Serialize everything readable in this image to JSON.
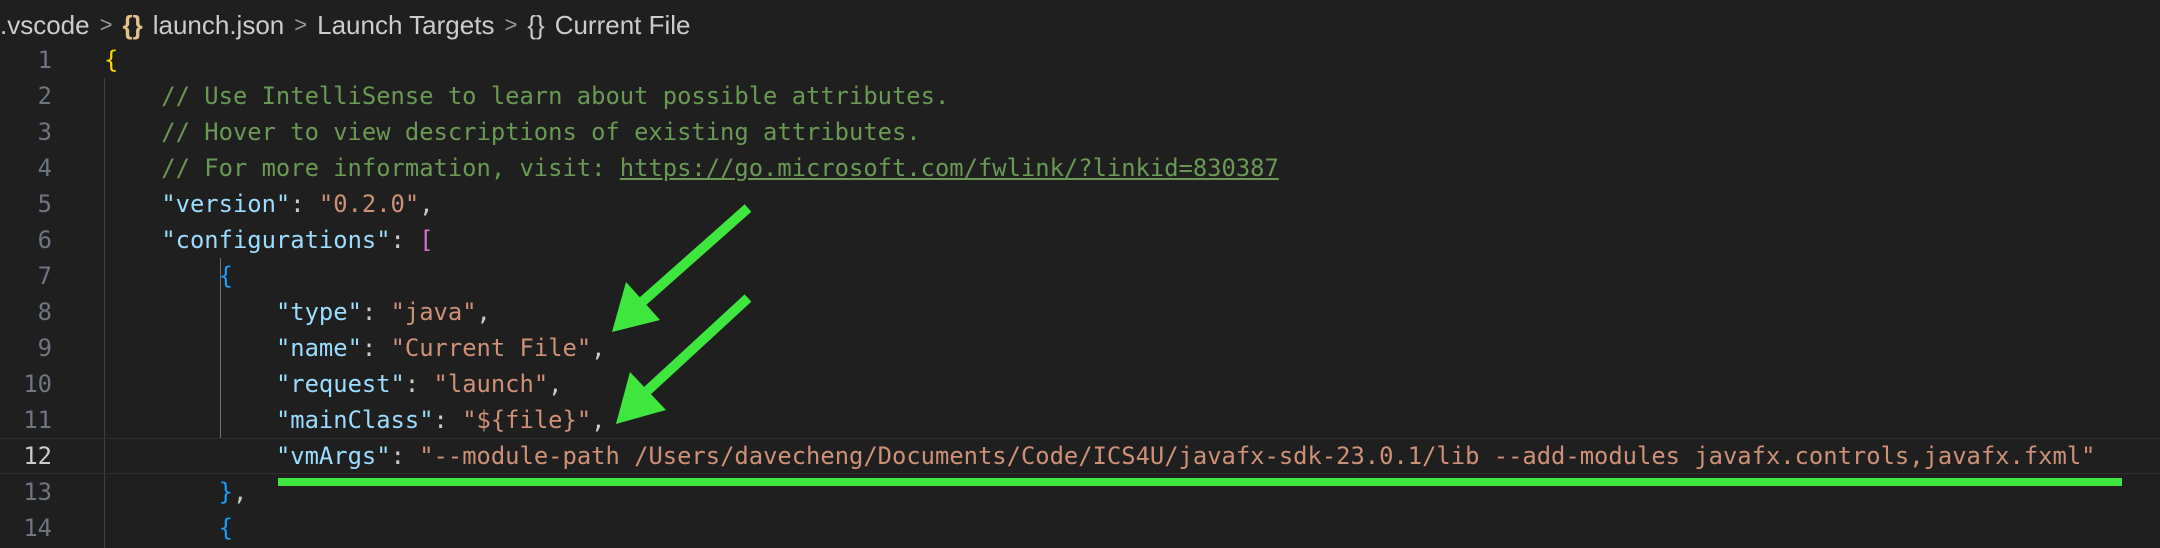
{
  "breadcrumb": {
    "items": [
      ".vscode",
      "launch.json",
      "Launch Targets",
      "Current File"
    ],
    "json_icon": "{}",
    "object_icon": "{}",
    "separator": ">"
  },
  "editor": {
    "current_line": 12,
    "lines": [
      {
        "n": "1",
        "tokens": [
          {
            "t": "{",
            "c": "brace1"
          }
        ]
      },
      {
        "n": "2",
        "tokens": [
          {
            "t": "    // Use IntelliSense to learn about possible attributes.",
            "c": "comment"
          }
        ]
      },
      {
        "n": "3",
        "tokens": [
          {
            "t": "    // Hover to view descriptions of existing attributes.",
            "c": "comment"
          }
        ]
      },
      {
        "n": "4",
        "tokens": [
          {
            "t": "    // For more information, visit: ",
            "c": "comment"
          },
          {
            "t": "https://go.microsoft.com/fwlink/?linkid=830387",
            "c": "comment link"
          }
        ]
      },
      {
        "n": "5",
        "tokens": [
          {
            "t": "    ",
            "c": "punc"
          },
          {
            "t": "\"version\"",
            "c": "key"
          },
          {
            "t": ": ",
            "c": "punc"
          },
          {
            "t": "\"0.2.0\"",
            "c": "str"
          },
          {
            "t": ",",
            "c": "punc"
          }
        ]
      },
      {
        "n": "6",
        "tokens": [
          {
            "t": "    ",
            "c": "punc"
          },
          {
            "t": "\"configurations\"",
            "c": "key"
          },
          {
            "t": ": ",
            "c": "punc"
          },
          {
            "t": "[",
            "c": "brack2"
          }
        ]
      },
      {
        "n": "7",
        "tokens": [
          {
            "t": "        ",
            "c": "punc"
          },
          {
            "t": "{",
            "c": "brace3"
          }
        ]
      },
      {
        "n": "8",
        "tokens": [
          {
            "t": "            ",
            "c": "punc"
          },
          {
            "t": "\"type\"",
            "c": "key"
          },
          {
            "t": ": ",
            "c": "punc"
          },
          {
            "t": "\"java\"",
            "c": "str"
          },
          {
            "t": ",",
            "c": "punc"
          }
        ]
      },
      {
        "n": "9",
        "tokens": [
          {
            "t": "            ",
            "c": "punc"
          },
          {
            "t": "\"name\"",
            "c": "key"
          },
          {
            "t": ": ",
            "c": "punc"
          },
          {
            "t": "\"Current File\"",
            "c": "str"
          },
          {
            "t": ",",
            "c": "punc"
          }
        ]
      },
      {
        "n": "10",
        "tokens": [
          {
            "t": "            ",
            "c": "punc"
          },
          {
            "t": "\"request\"",
            "c": "key"
          },
          {
            "t": ": ",
            "c": "punc"
          },
          {
            "t": "\"launch\"",
            "c": "str"
          },
          {
            "t": ",",
            "c": "punc"
          }
        ]
      },
      {
        "n": "11",
        "tokens": [
          {
            "t": "            ",
            "c": "punc"
          },
          {
            "t": "\"mainClass\"",
            "c": "key"
          },
          {
            "t": ": ",
            "c": "punc"
          },
          {
            "t": "\"${file}\"",
            "c": "str"
          },
          {
            "t": ",",
            "c": "punc"
          }
        ]
      },
      {
        "n": "12",
        "tokens": [
          {
            "t": "            ",
            "c": "punc"
          },
          {
            "t": "\"vmArgs\"",
            "c": "key"
          },
          {
            "t": ": ",
            "c": "punc"
          },
          {
            "t": "\"--module-path /Users/davecheng/Documents/Code/ICS4U/javafx-sdk-23.0.1/lib --add-modules javafx.controls,javafx.fxml\"",
            "c": "str"
          }
        ]
      },
      {
        "n": "13",
        "tokens": [
          {
            "t": "        ",
            "c": "punc"
          },
          {
            "t": "}",
            "c": "brace3"
          },
          {
            "t": ",",
            "c": "punc"
          }
        ]
      },
      {
        "n": "14",
        "tokens": [
          {
            "t": "        ",
            "c": "punc"
          },
          {
            "t": "{",
            "c": "brace3"
          }
        ]
      }
    ]
  },
  "annotations": {
    "color": "#3ee63e",
    "arrows": [
      "arrow-to-name",
      "arrow-to-mainclass"
    ],
    "underline": "vmargs-underline"
  }
}
